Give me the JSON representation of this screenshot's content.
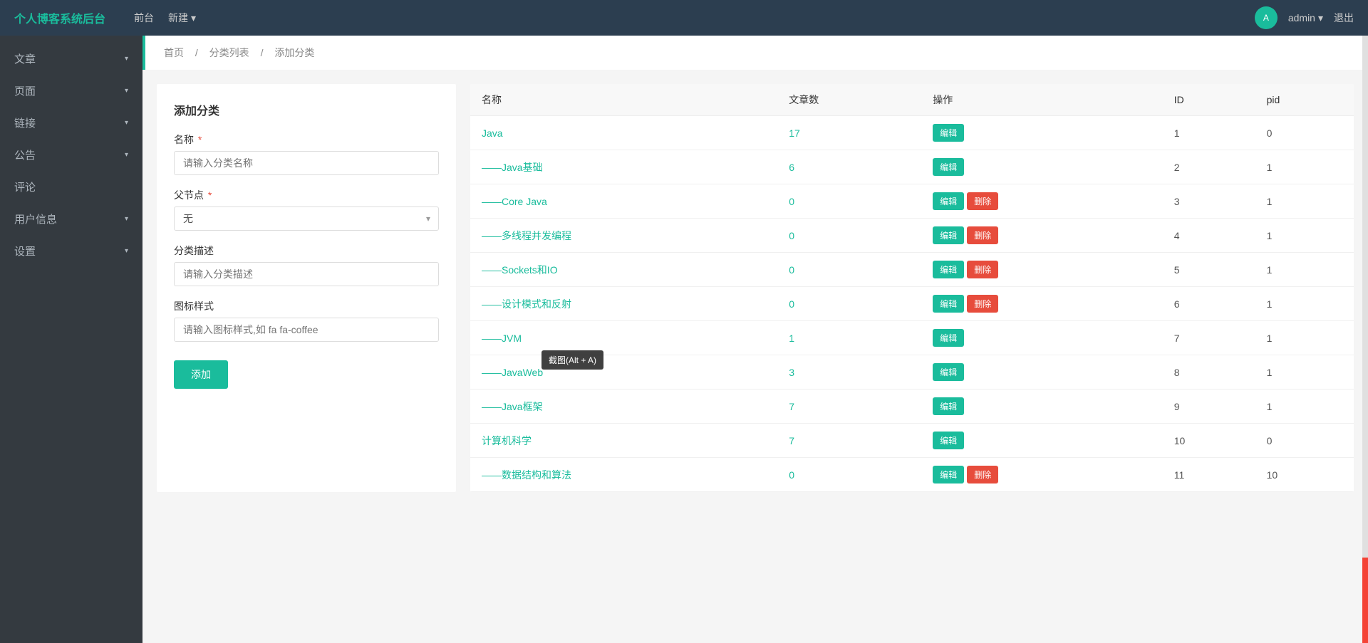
{
  "app": {
    "brand": "个人博客系统后台",
    "nav": {
      "items": [
        {
          "label": "前台",
          "hasDropdown": false
        },
        {
          "label": "新建",
          "hasDropdown": true
        }
      ]
    },
    "user": {
      "name": "admin",
      "logout": "退出"
    }
  },
  "sidebar": {
    "items": [
      {
        "label": "文章",
        "hasDropdown": true
      },
      {
        "label": "页面",
        "hasDropdown": true
      },
      {
        "label": "链接",
        "hasDropdown": true
      },
      {
        "label": "公告",
        "hasDropdown": true
      },
      {
        "label": "评论",
        "hasDropdown": false
      },
      {
        "label": "用户信息",
        "hasDropdown": true
      },
      {
        "label": "设置",
        "hasDropdown": true
      }
    ]
  },
  "breadcrumb": {
    "home": "首页",
    "sep1": "/",
    "list": "分类列表",
    "sep2": "/",
    "current": "添加分类"
  },
  "form": {
    "title": "添加分类",
    "name_label": "名称",
    "name_placeholder": "请输入分类名称",
    "parent_label": "父节点",
    "parent_value": "无",
    "desc_label": "分类描述",
    "desc_placeholder": "请输入分类描述",
    "icon_label": "图标样式",
    "icon_placeholder": "请输入图标样式,如 fa fa-coffee",
    "submit_label": "添加"
  },
  "table": {
    "headers": [
      "名称",
      "文章数",
      "操作",
      "ID",
      "pid"
    ],
    "rows": [
      {
        "name": "Java",
        "indent": 0,
        "count": "17",
        "edit": true,
        "delete": false,
        "id": "1",
        "pid": "0"
      },
      {
        "name": "——Java基础",
        "indent": 1,
        "count": "6",
        "edit": true,
        "delete": false,
        "id": "2",
        "pid": "1"
      },
      {
        "name": "——Core Java",
        "indent": 1,
        "count": "0",
        "edit": true,
        "delete": true,
        "id": "3",
        "pid": "1"
      },
      {
        "name": "——多线程并发编程",
        "indent": 1,
        "count": "0",
        "edit": true,
        "delete": true,
        "id": "4",
        "pid": "1"
      },
      {
        "name": "——Sockets和IO",
        "indent": 1,
        "count": "0",
        "edit": true,
        "delete": true,
        "id": "5",
        "pid": "1"
      },
      {
        "name": "——设计模式和反射",
        "indent": 1,
        "count": "0",
        "edit": true,
        "delete": true,
        "id": "6",
        "pid": "1"
      },
      {
        "name": "——JVM",
        "indent": 1,
        "count": "1",
        "edit": true,
        "delete": false,
        "id": "7",
        "pid": "1"
      },
      {
        "name": "——JavaWeb",
        "indent": 1,
        "count": "3",
        "edit": true,
        "delete": false,
        "id": "8",
        "pid": "1"
      },
      {
        "name": "——Java框架",
        "indent": 1,
        "count": "7",
        "edit": true,
        "delete": false,
        "id": "9",
        "pid": "1"
      },
      {
        "name": "计算机科学",
        "indent": 0,
        "count": "7",
        "edit": true,
        "delete": false,
        "id": "10",
        "pid": "0"
      },
      {
        "name": "——数据结构和算法",
        "indent": 1,
        "count": "0",
        "edit": true,
        "delete": true,
        "id": "11",
        "pid": "10"
      }
    ],
    "edit_btn": "编辑",
    "delete_btn": "删除"
  },
  "tooltip": {
    "text": "截图(Alt + A)"
  }
}
